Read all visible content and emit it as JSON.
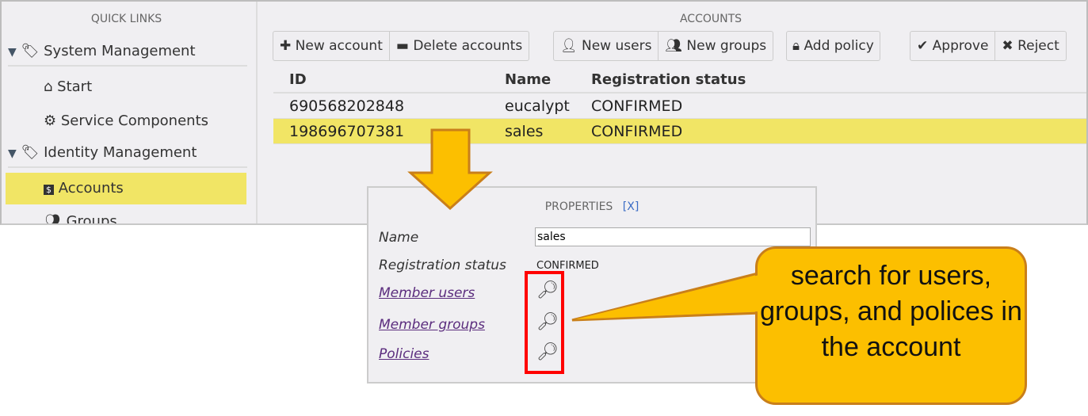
{
  "sidebar": {
    "title": "QUICK LINKS",
    "groups": [
      {
        "label": "System Management",
        "items": [
          {
            "label": "Start"
          },
          {
            "label": "Service Components"
          }
        ]
      },
      {
        "label": "Identity Management",
        "items": [
          {
            "label": "Accounts",
            "selected": true
          },
          {
            "label": "Groups"
          }
        ]
      }
    ]
  },
  "main": {
    "title": "ACCOUNTS",
    "toolbar": {
      "new_account": "New account",
      "delete_accounts": "Delete accounts",
      "new_users": "New users",
      "new_groups": "New groups",
      "add_policy": "Add policy",
      "approve": "Approve",
      "reject": "Reject"
    },
    "table": {
      "columns": [
        "ID",
        "Name",
        "Registration status"
      ],
      "rows": [
        [
          "690568202848",
          "eucalypt",
          "CONFIRMED"
        ],
        [
          "198696707381",
          "sales",
          "CONFIRMED"
        ]
      ],
      "selected_row": 1
    }
  },
  "properties": {
    "title": "PROPERTIES",
    "close": "[X]",
    "name_label": "Name",
    "name_value": "sales",
    "status_label": "Registration status",
    "status_value": "CONFIRMED",
    "member_users": "Member users",
    "member_groups": "Member groups",
    "policies": "Policies"
  },
  "callout": {
    "text": "search for users, groups, and polices in the account"
  },
  "colors": {
    "highlight": "#f1e565",
    "callout": "#fcbf00",
    "arrow": "#fcbf00",
    "red_box": "#ff0000",
    "link": "#5b2d7e"
  }
}
